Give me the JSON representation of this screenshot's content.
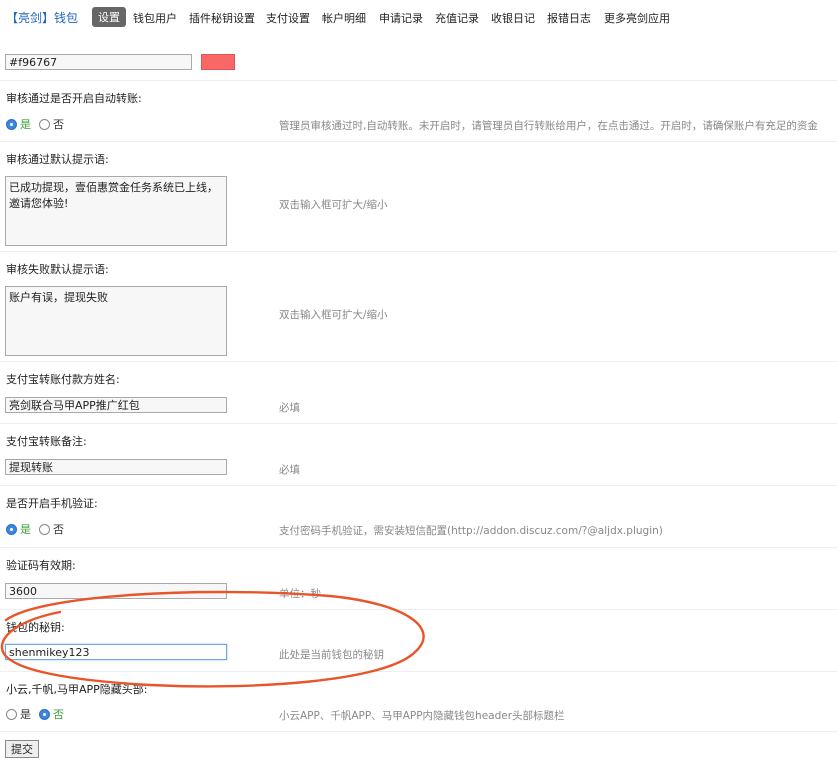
{
  "nav": {
    "brand": "【亮剑】钱包",
    "items": [
      {
        "label": "设置",
        "active": true
      },
      {
        "label": "钱包用户"
      },
      {
        "label": "插件秘钥设置"
      },
      {
        "label": "支付设置"
      },
      {
        "label": "帐户明细"
      },
      {
        "label": "申请记录"
      },
      {
        "label": "充值记录"
      },
      {
        "label": "收银日记"
      },
      {
        "label": "报错日志"
      },
      {
        "label": "更多亮剑应用"
      }
    ]
  },
  "color_field": {
    "value": "#f96767",
    "swatch_color": "#f96767"
  },
  "auto_transfer": {
    "label": "审核通过是否开启自动转账:",
    "option_yes": "是",
    "option_no": "否",
    "selected": "yes",
    "tip": "管理员审核通过时,自动转账。未开启时，请管理员自行转账给用户，在点击通过。开启时，请确保账户有充足的资金"
  },
  "approve_msg": {
    "label": "审核通过默认提示语:",
    "value": "已成功提现，壹佰惠赏金任务系统已上线， 邀请您体验!",
    "tip": "双击输入框可扩大/缩小"
  },
  "reject_msg": {
    "label": "审核失败默认提示语:",
    "value": "账户有误，提现失败",
    "tip": "双击输入框可扩大/缩小"
  },
  "payer_name": {
    "label": "支付宝转账付款方姓名:",
    "value": "亮剑联合马甲APP推广红包",
    "tip": "必填"
  },
  "transfer_note": {
    "label": "支付宝转账备注:",
    "value": "提现转账",
    "tip": "必填"
  },
  "phone_verify": {
    "label": "是否开启手机验证:",
    "option_yes": "是",
    "option_no": "否",
    "selected": "yes",
    "tip": "支付密码手机验证，需安装短信配置(http://addon.discuz.com/?@aljdx.plugin)"
  },
  "code_expiry": {
    "label": "验证码有效期:",
    "value": "3600",
    "tip": "单位：秒"
  },
  "wallet_key": {
    "label": "钱包的秘钥:",
    "value": "shenmikey123",
    "tip": "此处是当前钱包的秘钥"
  },
  "hide_header": {
    "label": "小云,千帆,马甲APP隐藏头部:",
    "option_yes": "是",
    "option_no": "否",
    "selected": "no",
    "tip": "小云APP、千帆APP、马甲APP内隐藏钱包header头部标题栏"
  },
  "submit": {
    "label": "提交"
  },
  "colors": {
    "annotation": "#e8552a",
    "accent": "#3a86e0",
    "selected_text": "#3aa03a"
  }
}
